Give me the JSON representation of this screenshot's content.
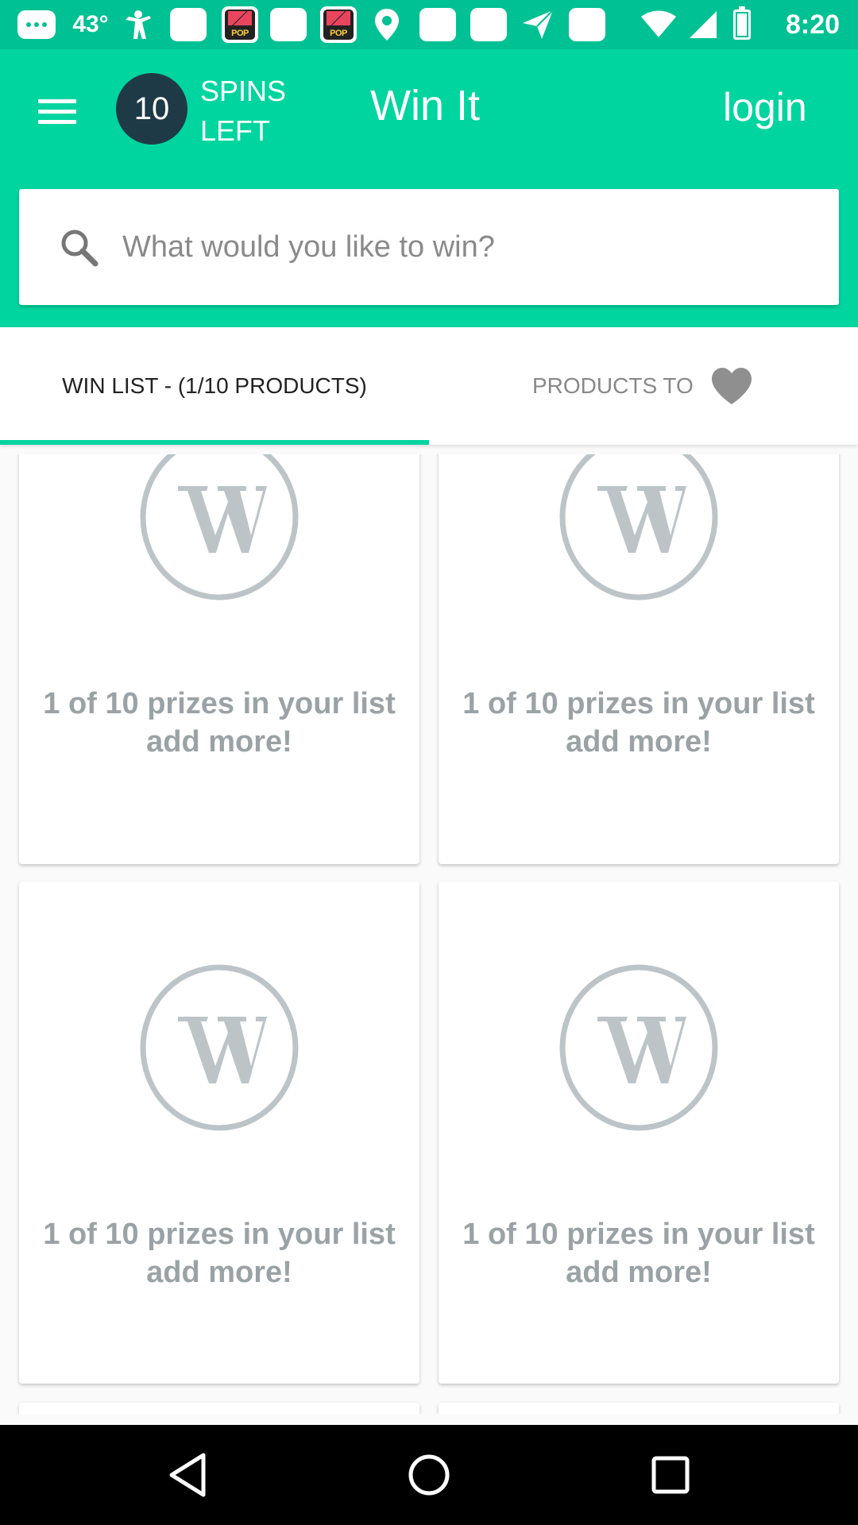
{
  "status_bar": {
    "temperature": "43°",
    "time": "8:20",
    "pop_text": "POP",
    "icons": [
      "messages-icon",
      "figure-icon",
      "app-square-icon",
      "pop-app-icon",
      "app-square-icon",
      "pop-app-icon",
      "location-pin-icon",
      "app-square-icon",
      "app-square-icon",
      "send-icon",
      "app-square-icon",
      "wifi-icon",
      "signal-icon",
      "battery-icon"
    ]
  },
  "app_bar": {
    "menu_icon": "hamburger-menu-icon",
    "spins_count": "10",
    "spins_label": "SPINS LEFT",
    "title": "Win It",
    "login_label": "login",
    "background": "#00d59f"
  },
  "search": {
    "placeholder": "What would you like to win?",
    "value": "",
    "icon": "search-icon"
  },
  "tabs": [
    {
      "label": "WIN LIST - (1/10 PRODUCTS)",
      "selected": true
    },
    {
      "label": "PRODUCTS TO",
      "icon": "heart-icon",
      "selected": false
    }
  ],
  "cards": [
    {
      "caption": "1 of 10 prizes in your list add more!",
      "icon": "w-logo-icon"
    },
    {
      "caption": "1 of 10 prizes in your list add more!",
      "icon": "w-logo-icon"
    },
    {
      "caption": "1 of 10 prizes in your list add more!",
      "icon": "w-logo-icon"
    },
    {
      "caption": "1 of 10 prizes in your list add more!",
      "icon": "w-logo-icon"
    }
  ],
  "nav_bar": {
    "buttons": [
      "back-icon",
      "home-icon",
      "recents-icon"
    ]
  },
  "colors": {
    "accent": "#00d59f",
    "badge": "#1e3a46",
    "card_text": "#9ba2a6"
  }
}
